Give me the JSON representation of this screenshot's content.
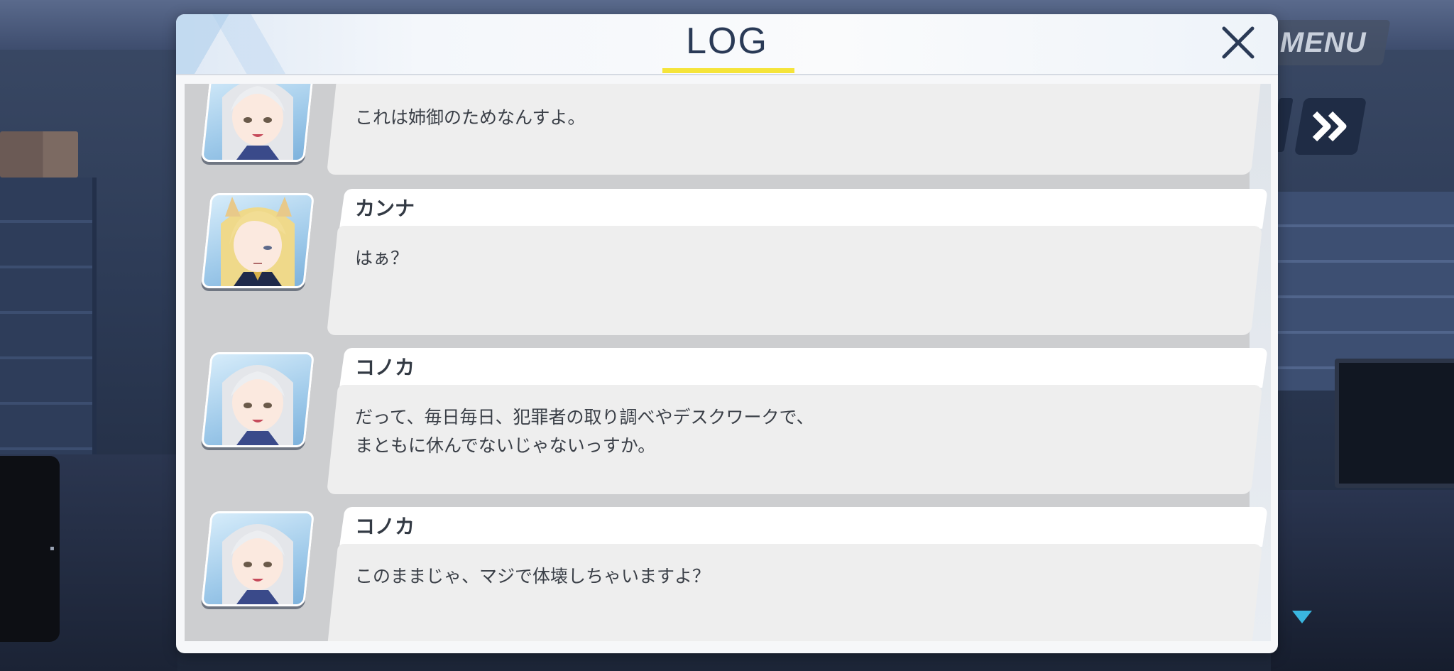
{
  "log": {
    "title": "LOG",
    "entries": [
      {
        "speaker": "",
        "portrait": "konoka-portrait",
        "text": "これは姉御のためなんすよ。"
      },
      {
        "speaker": "カンナ",
        "portrait": "kanna-portrait",
        "text": "はぁ？"
      },
      {
        "speaker": "コノカ",
        "portrait": "konoka-portrait",
        "text": "だって、毎日毎日、犯罪者の取り調べやデスクワークで、\nまともに休んでないじゃないっすか。"
      },
      {
        "speaker": "コノカ",
        "portrait": "konoka-portrait",
        "text": "このままじゃ、マジで体壊しちゃいますよ？"
      }
    ]
  },
  "hud": {
    "menu_label": "MENU",
    "icons": [
      "close-icon",
      "fast-forward-icon",
      "down-arrow-icon"
    ]
  },
  "colors": {
    "title_underline": "#f5e43a",
    "title_text": "#2a3a56",
    "hud_button": "#1f2c45"
  }
}
